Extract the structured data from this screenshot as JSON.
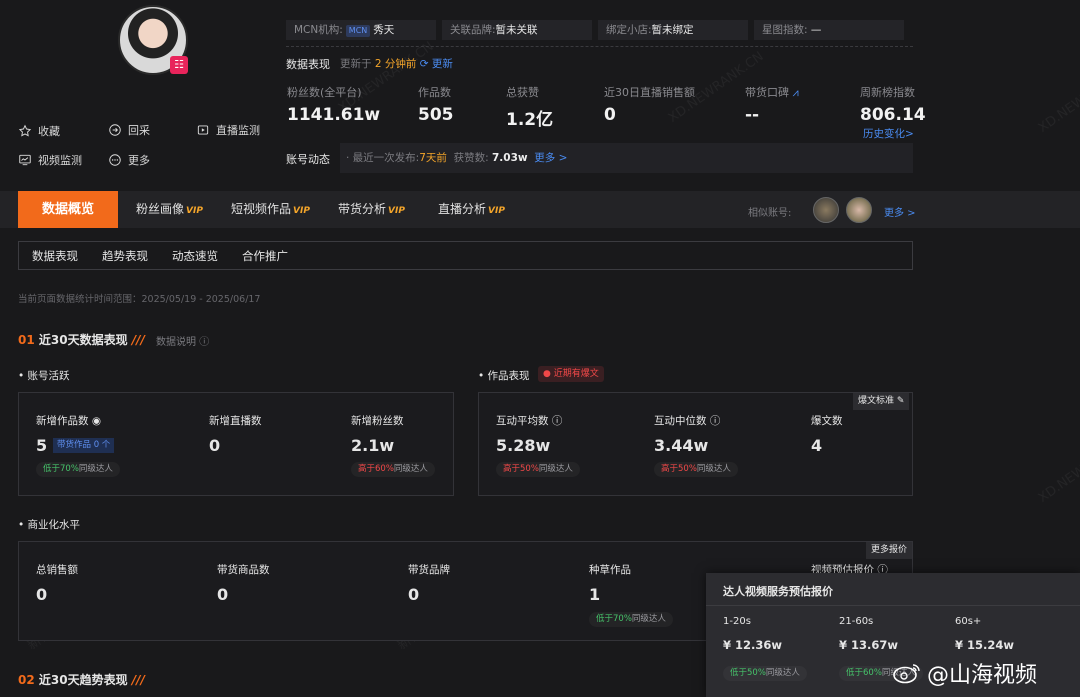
{
  "profile": {
    "qr_glyph": "☷",
    "actions": [
      {
        "label": "收藏",
        "icon": "star-icon"
      },
      {
        "label": "回采",
        "icon": "login-icon"
      },
      {
        "label": "直播监测",
        "icon": "live-icon"
      },
      {
        "label": "视频监测",
        "icon": "video-monitor-icon"
      },
      {
        "label": "更多",
        "icon": "more-icon"
      }
    ],
    "tags": [
      {
        "k": "MCN机构:",
        "mcn": "MCN",
        "v": "秀天"
      },
      {
        "k": "关联品牌:",
        "v": "暂未关联"
      },
      {
        "k": "绑定小店:",
        "v": "暂未绑定"
      },
      {
        "k": "星图指数:",
        "v": "—"
      }
    ]
  },
  "performance": {
    "title": "数据表现",
    "updated_prefix": "更新于",
    "updated_time": "2 分钟前",
    "refresh": "更新",
    "stats": [
      {
        "label": "粉丝数(全平台)",
        "value": "1141.61w"
      },
      {
        "label": "作品数",
        "value": "505"
      },
      {
        "label": "总获赞",
        "value": "1.2亿"
      },
      {
        "label": "近30日直播销售额",
        "value": "0"
      },
      {
        "label": "带货口碑",
        "value": "--"
      },
      {
        "label": "周新榜指数",
        "value": "806.14",
        "link": "历史变化>"
      }
    ],
    "dynamic_label": "账号动态",
    "dynamic_prefix": "· 最近一次发布:",
    "dynamic_time": "7天前",
    "dynamic_likes_label": "获赞数:",
    "dynamic_likes": "7.03w",
    "dynamic_more": "更多 >"
  },
  "tabs": {
    "active": "数据概览",
    "items": [
      {
        "label": "粉丝画像",
        "vip": "VIP"
      },
      {
        "label": "短视频作品",
        "vip": "VIP"
      },
      {
        "label": "带货分析",
        "vip": "VIP"
      },
      {
        "label": "直播分析",
        "vip": "VIP"
      }
    ],
    "similar": "相似账号:",
    "more": "更多 >"
  },
  "subtabs": [
    "数据表现",
    "趋势表现",
    "动态速览",
    "合作推广"
  ],
  "range": "当前页面数据统计时间范围：2025/05/19 - 2025/06/17",
  "section1": {
    "num": "01",
    "title": "近30天数据表现",
    "note": "数据说明"
  },
  "activity": {
    "title": "账号活跃",
    "items": [
      {
        "label": "新增作品数",
        "value": "5",
        "badge": "带货作品 0 个",
        "pill_a": "低于70%",
        "pill_b": "同级达人"
      },
      {
        "label": "新增直播数",
        "value": "0"
      },
      {
        "label": "新增粉丝数",
        "value": "2.1w",
        "pill_a": "高于60%",
        "pill_b": "同级达人"
      }
    ]
  },
  "works": {
    "title": "作品表现",
    "hot": "近期有爆文",
    "std": "爆文标准",
    "items": [
      {
        "label": "互动平均数",
        "value": "5.28w",
        "pill_a": "高于50%",
        "pill_b": "同级达人"
      },
      {
        "label": "互动中位数",
        "value": "3.44w",
        "pill_a": "高于50%",
        "pill_b": "同级达人"
      },
      {
        "label": "爆文数",
        "value": "4"
      }
    ]
  },
  "commercial": {
    "title": "商业化水平",
    "more_price": "更多报价",
    "items": [
      {
        "label": "总销售额",
        "value": "0"
      },
      {
        "label": "带货商品数",
        "value": "0"
      },
      {
        "label": "带货品牌",
        "value": "0"
      },
      {
        "label": "种草作品",
        "value": "1",
        "pill_a": "低于70%",
        "pill_b": "同级达人"
      },
      {
        "label": "视频预估报价"
      }
    ]
  },
  "popup": {
    "title": "达人视频服务预估报价",
    "cols": [
      {
        "range": "1-20s",
        "price": "¥ 12.36w",
        "pill_a": "低于50%",
        "pill_b": "同级达人"
      },
      {
        "range": "21-60s",
        "price": "¥ 13.67w",
        "pill_a": "低于60%",
        "pill_b": "同级达人"
      },
      {
        "range": "60s+",
        "price": "¥ 15.24w"
      }
    ]
  },
  "section2": {
    "num": "02",
    "title": "近30天趋势表现"
  },
  "watermarks": [
    "XD.NEWRANK.CN",
    "新榜有数 · 新抖"
  ],
  "weibo": "@山海视频"
}
